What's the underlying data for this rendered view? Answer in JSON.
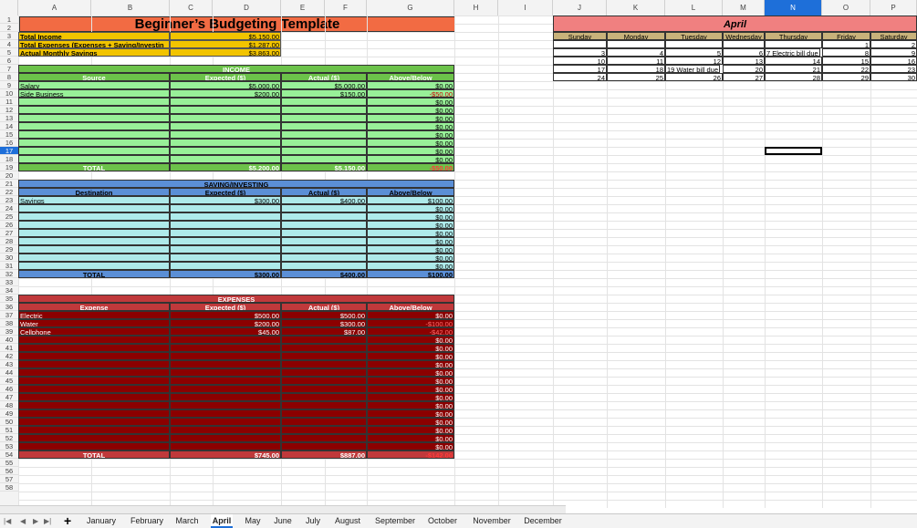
{
  "columns": [
    "A",
    "B",
    "C",
    "D",
    "E",
    "F",
    "G",
    "H",
    "I",
    "J",
    "K",
    "L",
    "M",
    "N",
    "O",
    "P"
  ],
  "selected_column": "N",
  "rows": [
    "1",
    "2",
    "3",
    "4",
    "5",
    "6",
    "7",
    "8",
    "9",
    "10",
    "11",
    "12",
    "13",
    "14",
    "15",
    "16",
    "17",
    "18",
    "19",
    "20",
    "21",
    "22",
    "23",
    "24",
    "25",
    "26",
    "27",
    "28",
    "29",
    "30",
    "31",
    "32",
    "33",
    "34",
    "35",
    "36",
    "37",
    "38",
    "39",
    "40",
    "41",
    "42",
    "43",
    "44",
    "45",
    "46",
    "47",
    "48",
    "49",
    "50",
    "51",
    "52",
    "53",
    "54",
    "55",
    "56",
    "57",
    "58"
  ],
  "selected_row": "17",
  "title": "Beginner’s Budgeting Template",
  "summary": {
    "total_income_label": "Total Income",
    "total_income": "$5,150.00",
    "total_expenses_label": "Total Expenses (Expenses + Saving/Investin",
    "total_expenses": "$1,287.00",
    "savings_label": "Actual Monthly Savings",
    "savings": "$3,863.00"
  },
  "income": {
    "header": "INCOME",
    "cols": [
      "Source",
      "Expected ($)",
      "Actual ($)",
      "Above/Below"
    ],
    "rows": [
      [
        "Salary",
        "$5,000.00",
        "$5,000.00",
        "$0.00"
      ],
      [
        "Side Business",
        "$200.00",
        "$150.00",
        "-$50.00"
      ],
      [
        "",
        "",
        "",
        "$0.00"
      ],
      [
        "",
        "",
        "",
        "$0.00"
      ],
      [
        "",
        "",
        "",
        "$0.00"
      ],
      [
        "",
        "",
        "",
        "$0.00"
      ],
      [
        "",
        "",
        "",
        "$0.00"
      ],
      [
        "",
        "",
        "",
        "$0.00"
      ],
      [
        "",
        "",
        "",
        "$0.00"
      ],
      [
        "",
        "",
        "",
        "$0.00"
      ]
    ],
    "total": [
      "TOTAL",
      "$5,200.00",
      "$5,150.00",
      "-$50.00"
    ]
  },
  "saving": {
    "header": "SAVING/INVESTING",
    "cols": [
      "Destination",
      "Expected ($)",
      "Actual ($)",
      "Above/Below"
    ],
    "rows": [
      [
        "Savings",
        "$300.00",
        "$400.00",
        "$100.00"
      ],
      [
        "",
        "",
        "",
        "$0.00"
      ],
      [
        "",
        "",
        "",
        "$0.00"
      ],
      [
        "",
        "",
        "",
        "$0.00"
      ],
      [
        "",
        "",
        "",
        "$0.00"
      ],
      [
        "",
        "",
        "",
        "$0.00"
      ],
      [
        "",
        "",
        "",
        "$0.00"
      ],
      [
        "",
        "",
        "",
        "$0.00"
      ],
      [
        "",
        "",
        "",
        "$0.00"
      ]
    ],
    "total": [
      "TOTAL",
      "$300.00",
      "$400.00",
      "$100.00"
    ]
  },
  "expenses": {
    "header": "EXPENSES",
    "cols": [
      "Expense",
      "Expected ($)",
      "Actual ($)",
      "Above/Below"
    ],
    "rows": [
      [
        "Electric",
        "$500.00",
        "$500.00",
        "$0.00"
      ],
      [
        "Water",
        "$200.00",
        "$300.00",
        "-$100.00"
      ],
      [
        "Cellphone",
        "$45.00",
        "$87.00",
        "-$42.00"
      ],
      [
        "",
        "",
        "",
        "$0.00"
      ],
      [
        "",
        "",
        "",
        "$0.00"
      ],
      [
        "",
        "",
        "",
        "$0.00"
      ],
      [
        "",
        "",
        "",
        "$0.00"
      ],
      [
        "",
        "",
        "",
        "$0.00"
      ],
      [
        "",
        "",
        "",
        "$0.00"
      ],
      [
        "",
        "",
        "",
        "$0.00"
      ],
      [
        "",
        "",
        "",
        "$0.00"
      ],
      [
        "",
        "",
        "",
        "$0.00"
      ],
      [
        "",
        "",
        "",
        "$0.00"
      ],
      [
        "",
        "",
        "",
        "$0.00"
      ],
      [
        "",
        "",
        "",
        "$0.00"
      ],
      [
        "",
        "",
        "",
        "$0.00"
      ],
      [
        "",
        "",
        "",
        "$0.00"
      ]
    ],
    "total": [
      "TOTAL",
      "$745.00",
      "$887.00",
      "-$142.00"
    ]
  },
  "calendar": {
    "month": "April",
    "days": [
      "Sunday",
      "Monday",
      "Tuesday",
      "Wednesday",
      "Thursday",
      "Friday",
      "Saturday"
    ],
    "weeks": [
      [
        "",
        "",
        "",
        "",
        "",
        "1",
        "2"
      ],
      [
        "3",
        "4",
        "5",
        "6",
        "7 Electric bill due",
        "8",
        "9"
      ],
      [
        "10",
        "11",
        "12",
        "13",
        "14",
        "15",
        "16"
      ],
      [
        "17",
        "18",
        "19 Water bill due",
        "20",
        "21",
        "22",
        "23"
      ],
      [
        "24",
        "25",
        "26",
        "27",
        "28",
        "29",
        "30"
      ]
    ]
  },
  "sheet_tabs": [
    "January",
    "February",
    "March",
    "April",
    "May",
    "June",
    "July",
    "August",
    "September",
    "October",
    "November",
    "December"
  ],
  "active_tab": "April",
  "colors": {
    "title": "#f26b43",
    "summary": "#f2c400",
    "income_header": "#6cc24a",
    "income_body": "#98f098",
    "saving_header": "#5b8fd6",
    "saving_body": "#aeeaea",
    "expense_header": "#c0393b",
    "expense_body": "#8b0000",
    "calendar_header": "#f08080",
    "calendar_days": "#c8b27a"
  }
}
